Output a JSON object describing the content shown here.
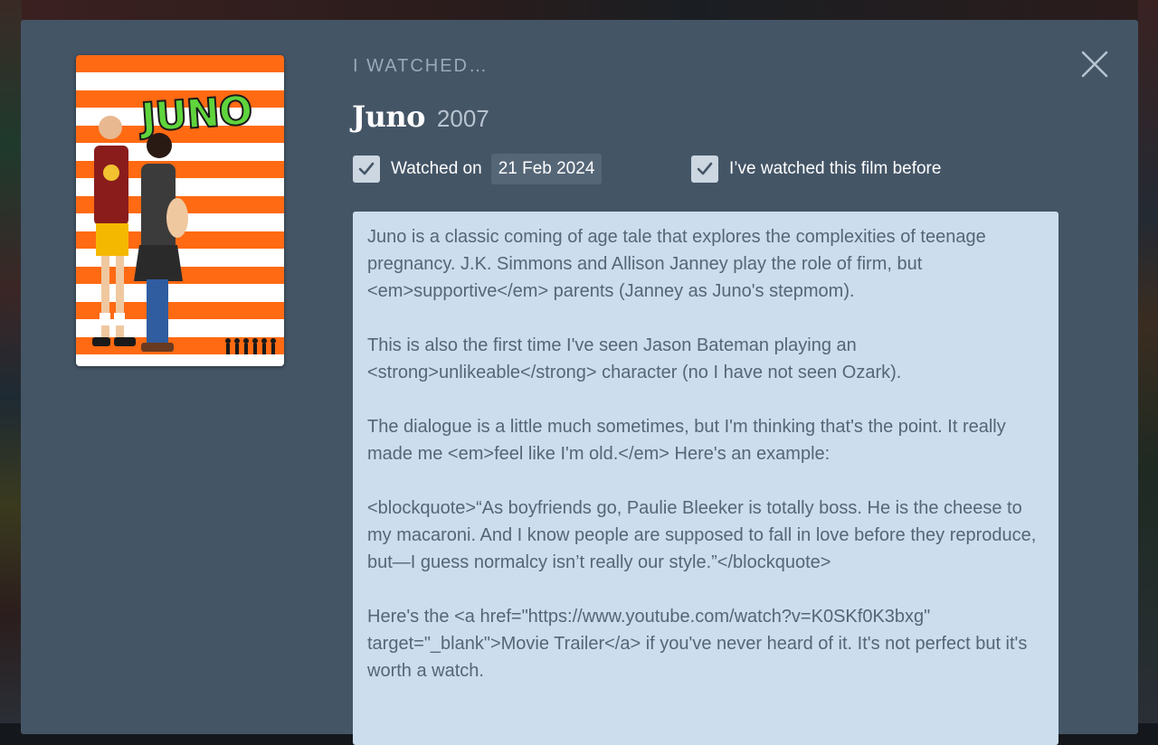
{
  "dialog": {
    "eyebrow": "I watched…",
    "close_icon": "close-icon"
  },
  "film": {
    "title": "Juno",
    "year": "2007",
    "poster_title": "JUNO"
  },
  "watched": {
    "checked": true,
    "label": "Watched on",
    "date": "21 Feb 2024"
  },
  "rewatch": {
    "checked": true,
    "label": "I’ve watched this film before"
  },
  "review": {
    "text": "Juno is a classic coming of age tale that explores the complexities of teenage pregnancy. J.K. Simmons and Allison Janney play the role of firm, but <em>supportive</em> parents (Janney as Juno's stepmom).\n\nThis is also the first time I've seen Jason Bateman playing an <strong>unlikeable</strong> character (no I have not seen Ozark).\n\nThe dialogue is a little much sometimes, but I'm thinking that's the point. It really made me <em>feel like I'm old.</em> Here's an example:\n\n<blockquote>“As boyfriends go, Paulie Bleeker is totally boss. He is the cheese to my macaroni. And I know people are supposed to fall in love before they reproduce, but—I guess normalcy isn’t really our style.”</blockquote>\n\nHere's the <a href=\"https://www.youtube.com/watch?v=K0SKf0K3bxg\" target=\"_blank\">Movie Trailer</a> if you've never heard of it. It's not perfect but it's worth a watch."
  },
  "colors": {
    "modal_bg": "#445566",
    "review_bg": "#ccdded",
    "review_text": "#556677",
    "eyebrow": "#99aabb",
    "poster_orange": "#ff6a12",
    "poster_title_green": "#5fd43c"
  }
}
